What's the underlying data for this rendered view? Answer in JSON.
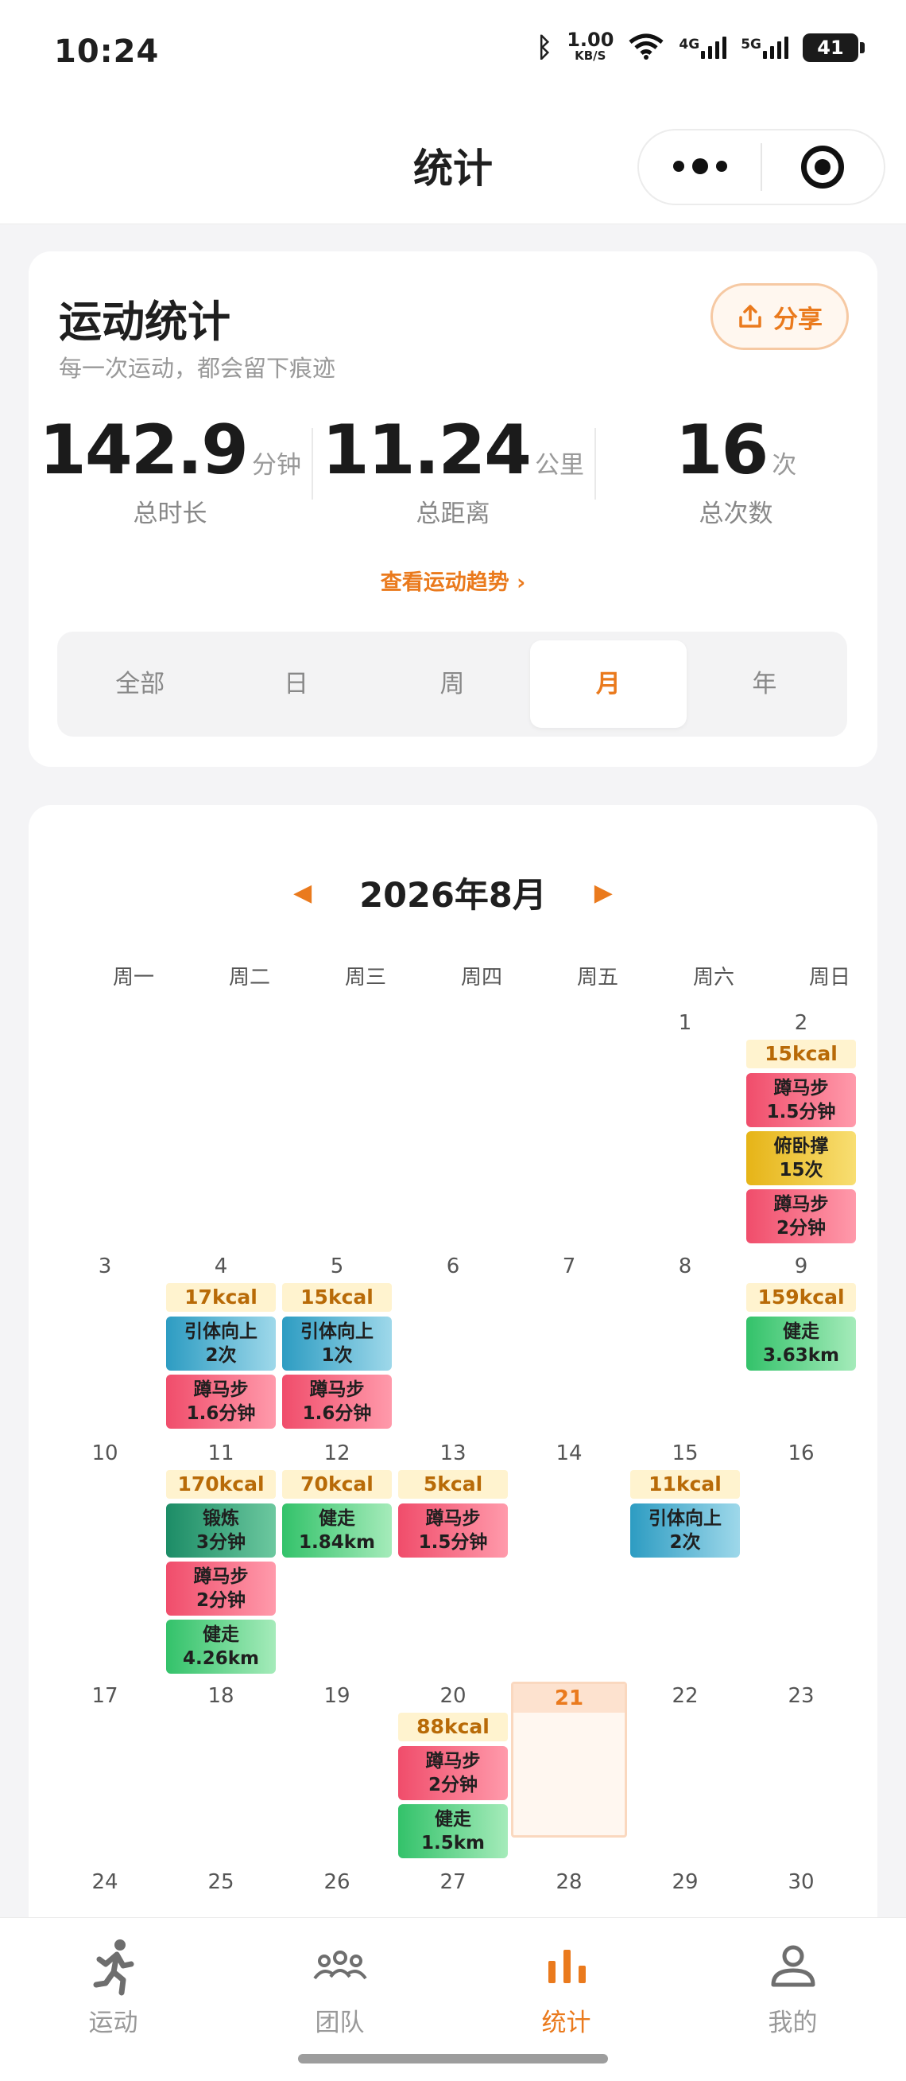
{
  "status_bar": {
    "time": "10:24",
    "net_speed": "1.00",
    "net_unit": "KB/S",
    "sig1": "4G",
    "sig2": "5G",
    "battery": "41"
  },
  "nav": {
    "title": "统计"
  },
  "stats": {
    "title": "运动统计",
    "subtitle": "每一次运动，都会留下痕迹",
    "share_label": "分享",
    "metrics": [
      {
        "value": "142.9",
        "unit": "分钟",
        "label": "总时长"
      },
      {
        "value": "11.24",
        "unit": "公里",
        "label": "总距离"
      },
      {
        "value": "16",
        "unit": "次",
        "label": "总次数"
      }
    ],
    "trend_link": "查看运动趋势 ›",
    "tabs": [
      {
        "label": "全部"
      },
      {
        "label": "日"
      },
      {
        "label": "周"
      },
      {
        "label": "月",
        "active": true
      },
      {
        "label": "年"
      }
    ]
  },
  "calendar": {
    "month_label": "2026年8月",
    "prev": "◀",
    "next": "▶",
    "weekdays": [
      "周一",
      "周二",
      "周三",
      "周四",
      "周五",
      "周六",
      "周日"
    ],
    "today": "21",
    "days": [
      {
        "d": "1"
      },
      {
        "d": "2",
        "kcal": "15kcal",
        "items": [
          {
            "type": "squat",
            "name": "蹲马步",
            "detail": "1.5分钟"
          },
          {
            "type": "pushup",
            "name": "俯卧撑",
            "detail": "15次"
          },
          {
            "type": "squat",
            "name": "蹲马步",
            "detail": "2分钟"
          }
        ]
      },
      {
        "d": "3"
      },
      {
        "d": "4",
        "kcal": "17kcal",
        "items": [
          {
            "type": "pullup",
            "name": "引体向上",
            "detail": "2次"
          },
          {
            "type": "squat",
            "name": "蹲马步",
            "detail": "1.6分钟"
          }
        ]
      },
      {
        "d": "5",
        "kcal": "15kcal",
        "items": [
          {
            "type": "pullup",
            "name": "引体向上",
            "detail": "1次"
          },
          {
            "type": "squat",
            "name": "蹲马步",
            "detail": "1.6分钟"
          }
        ]
      },
      {
        "d": "6"
      },
      {
        "d": "7"
      },
      {
        "d": "8"
      },
      {
        "d": "9",
        "kcal": "159kcal",
        "items": [
          {
            "type": "walk",
            "name": "健走",
            "detail": "3.63km"
          }
        ]
      },
      {
        "d": "10"
      },
      {
        "d": "11",
        "kcal": "170kcal",
        "items": [
          {
            "type": "train",
            "name": "锻炼",
            "detail": "3分钟"
          },
          {
            "type": "squat",
            "name": "蹲马步",
            "detail": "2分钟"
          },
          {
            "type": "walk",
            "name": "健走",
            "detail": "4.26km"
          }
        ]
      },
      {
        "d": "12",
        "kcal": "70kcal",
        "items": [
          {
            "type": "walk",
            "name": "健走",
            "detail": "1.84km"
          }
        ]
      },
      {
        "d": "13",
        "kcal": "5kcal",
        "items": [
          {
            "type": "squat",
            "name": "蹲马步",
            "detail": "1.5分钟"
          }
        ]
      },
      {
        "d": "14"
      },
      {
        "d": "15",
        "kcal": "11kcal",
        "items": [
          {
            "type": "pullup",
            "name": "引体向上",
            "detail": "2次"
          }
        ]
      },
      {
        "d": "16"
      },
      {
        "d": "17"
      },
      {
        "d": "18"
      },
      {
        "d": "19"
      },
      {
        "d": "20",
        "kcal": "88kcal",
        "items": [
          {
            "type": "squat",
            "name": "蹲马步",
            "detail": "2分钟"
          },
          {
            "type": "walk",
            "name": "健走",
            "detail": "1.5km"
          }
        ]
      },
      {
        "d": "21"
      },
      {
        "d": "22"
      },
      {
        "d": "23"
      },
      {
        "d": "24"
      },
      {
        "d": "25"
      },
      {
        "d": "26"
      },
      {
        "d": "27"
      },
      {
        "d": "28"
      },
      {
        "d": "29"
      },
      {
        "d": "30"
      }
    ]
  },
  "tabbar": {
    "items": [
      {
        "label": "运动",
        "icon": "run-icon"
      },
      {
        "label": "团队",
        "icon": "team-icon"
      },
      {
        "label": "统计",
        "icon": "stats-icon",
        "active": true
      },
      {
        "label": "我的",
        "icon": "user-icon"
      }
    ]
  },
  "colors": {
    "accent": "#ea7a1d",
    "kcal_bg": "#fff3cf"
  }
}
